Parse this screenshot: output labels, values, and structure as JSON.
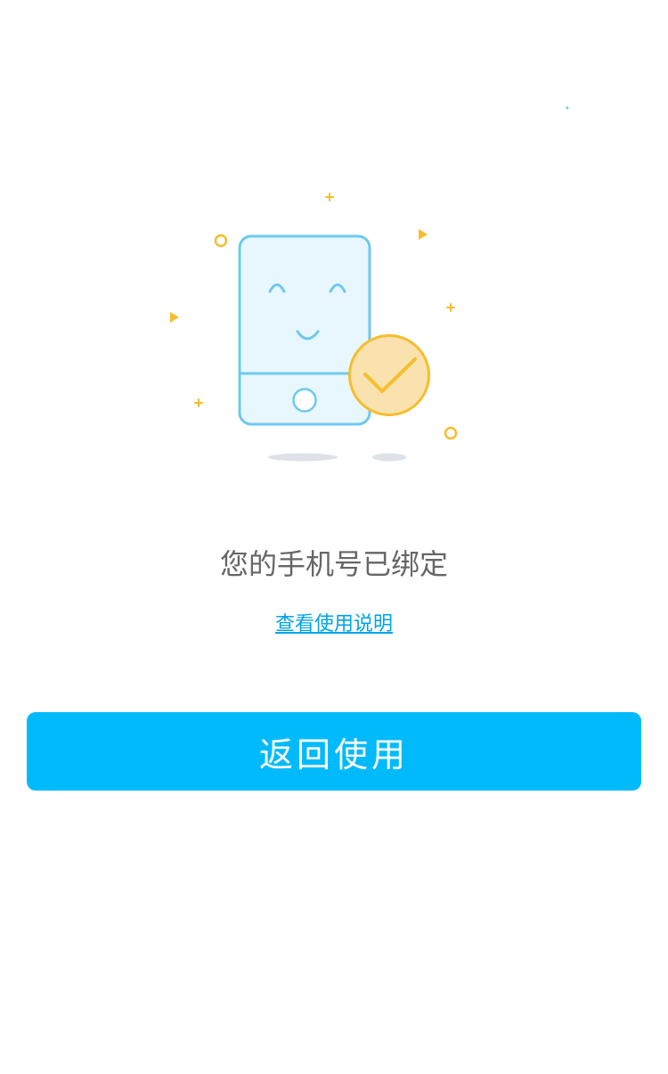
{
  "illustration": {
    "icon": "phone-bound-success-illustration",
    "colors": {
      "phone_stroke": "#6ec9ee",
      "phone_fill": "#e8f7fd",
      "check_badge_fill": "#f9e2ad",
      "check_badge_stroke": "#f6bd2e",
      "decor_yellow": "#f6bd2e",
      "shadow": "#dde2e8"
    }
  },
  "status": {
    "title": "您的手机号已绑定"
  },
  "help": {
    "link_text": "查看使用说明"
  },
  "actions": {
    "return_label": "返回使用",
    "button_color": "#00bafc"
  }
}
